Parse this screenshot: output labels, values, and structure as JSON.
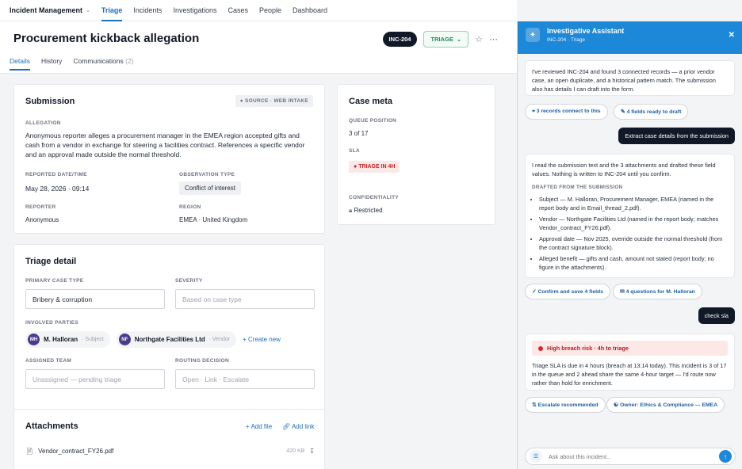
{
  "nav": {
    "brand": "Incident Management",
    "items": [
      "Triage",
      "Incidents",
      "Investigations",
      "Cases",
      "People",
      "Dashboard"
    ]
  },
  "page": {
    "title": "Procurement kickback allegation",
    "case_id": "INC-204",
    "status": "TRIAGE",
    "tabs": [
      {
        "label": "Details"
      },
      {
        "label": "History"
      },
      {
        "label": "Communications",
        "count": "(2)"
      }
    ]
  },
  "submission": {
    "title": "Submission",
    "source_badge": "SOURCE · WEB INTAKE",
    "allegation_label": "ALLEGATION",
    "allegation": "Anonymous reporter alleges a procurement manager in the EMEA region accepted gifts and cash from a vendor in exchange for steering a facilities contract. References a specific vendor and an approval made outside the normal threshold.",
    "reported_label": "REPORTED DATE/TIME",
    "reported": "May 28, 2026 · 09:14",
    "obs_label": "OBSERVATION TYPE",
    "obs": "Conflict of interest",
    "reporter_label": "REPORTER",
    "reporter": "Anonymous",
    "region_label": "REGION",
    "region": "EMEA · United Kingdom"
  },
  "meta": {
    "title": "Case meta",
    "queue_label": "QUEUE POSITION",
    "queue": "3 of 17",
    "sla_label": "SLA",
    "sla": "TRIAGE IN 4H",
    "conf_label": "CONFIDENTIALITY",
    "conf": "Restricted"
  },
  "triage": {
    "title": "Triage detail",
    "case_type_label": "PRIMARY CASE TYPE",
    "case_type": "Bribery & corruption",
    "severity_label": "SEVERITY",
    "severity_placeholder": "Based on case type",
    "parties_label": "INVOLVED PARTIES",
    "parties": [
      {
        "initials": "MH",
        "name": "M. Halloran",
        "role": "· Subject"
      },
      {
        "initials": "NF",
        "name": "Northgate Facilities Ltd",
        "role": "· Vendor"
      }
    ],
    "create_new": "+ Create new",
    "team_label": "ASSIGNED TEAM",
    "team_placeholder": "Unassigned — pending triage",
    "routing_label": "ROUTING DECISION",
    "routing_placeholder": "Open · Link · Escalate"
  },
  "attachments": {
    "title": "Attachments",
    "add_file": "+ Add file",
    "add_link": "Add link",
    "files": [
      {
        "name": "Vendor_contract_FY26.pdf",
        "size": "420 KB"
      }
    ]
  },
  "assistant": {
    "title": "Investigative Assistant",
    "subtitle": "INC-204 · Triage",
    "msg1": "I've reviewed INC-204 and found 3 connected records — a prior vendor case, an open duplicate, and a historical pattern match. The submission also has details I can draft into the form.",
    "chip_records": "3 records connect to this",
    "chip_fields": "4 fields ready to draft",
    "user1": "Extract case details from the submission",
    "msg2_intro": "I read the submission text and the 3 attachments and drafted these field values. Nothing is written to INC-204 until you confirm.",
    "msg2_label": "DRAFTED FROM THE SUBMISSION",
    "msg2_bullets": [
      "Subject — M. Halloran, Procurement Manager, EMEA (named in the report body and in Email_thread_2.pdf).",
      "Vendor — Northgate Facilities Ltd (named in the report body; matches Vendor_contract_FY26.pdf).",
      "Approval date — Nov 2025, override outside the normal threshold (from the contract signature block).",
      "Alleged benefit — gifts and cash, amount not stated (report body; no figure in the attachments)."
    ],
    "chip_confirm": "Confirm and save 4 fields",
    "chip_questions": "4 questions for M. Halloran",
    "user2": "check sla",
    "risk": "High breach risk · 4h to triage",
    "msg3": "Triage SLA is due in 4 hours (breach at 13:14 today). This incident is 3 of 17 in the queue and 2 ahead share the same 4-hour target — I'd route now rather than hold for enrichment.",
    "chip_escalate": "Escalate recommended",
    "chip_owner": "Owner: Ethics & Compliance — EMEA",
    "composer_placeholder": "Ask about this incident..."
  }
}
